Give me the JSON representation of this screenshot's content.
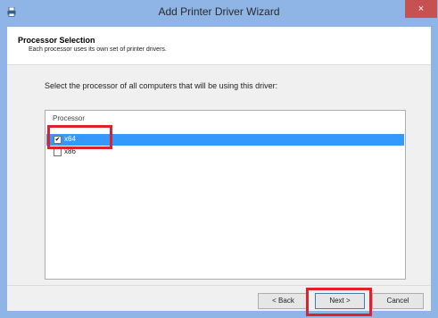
{
  "window": {
    "title": "Add Printer Driver Wizard",
    "close_glyph": "×",
    "accent_color": "#8fb5e6",
    "close_color": "#c75050"
  },
  "header": {
    "title": "Processor Selection",
    "description": "Each processor uses its own set of printer drivers."
  },
  "main": {
    "instruction": "Select the processor of all computers that will be using this driver:",
    "list": {
      "column_header": "Processor",
      "items": [
        {
          "label": "x64",
          "checked": true,
          "selected": true
        },
        {
          "label": "x86",
          "checked": false,
          "selected": false
        }
      ]
    }
  },
  "buttons": {
    "back": "< Back",
    "next": "Next >",
    "cancel": "Cancel"
  },
  "highlight_color": "#e0202a"
}
